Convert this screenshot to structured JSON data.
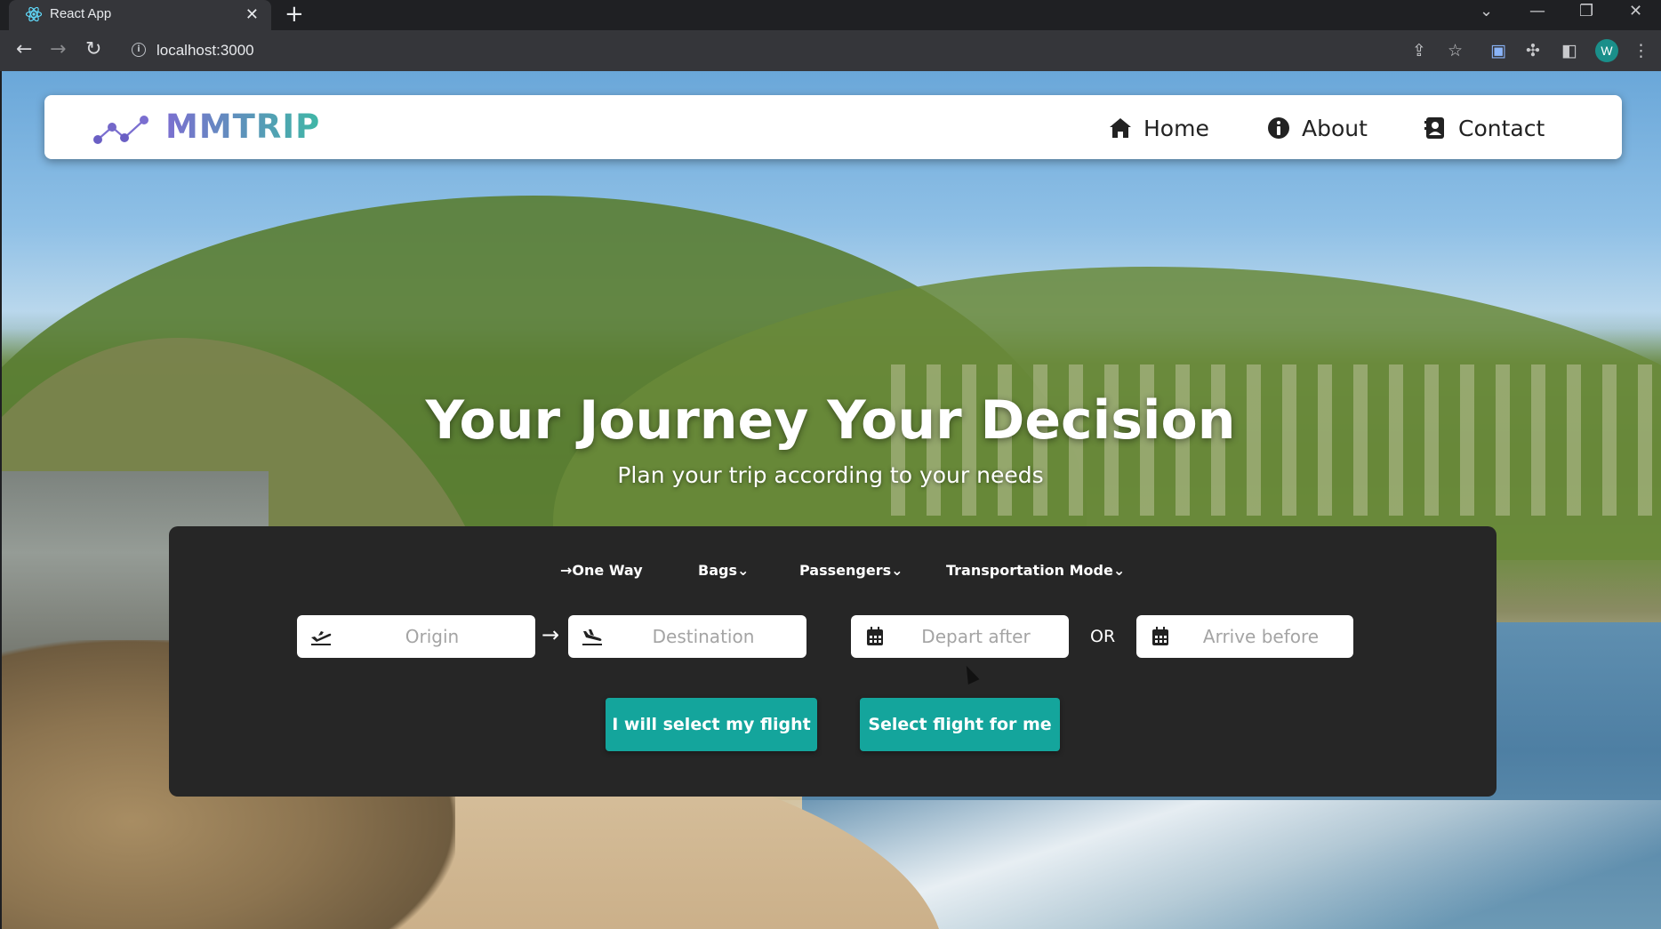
{
  "browser": {
    "tab_title": "React App",
    "tab_close_icon": "close-icon",
    "new_tab_label": "+",
    "url": "localhost:3000",
    "profile_initial": "W",
    "accent_profile_color": "#1a8f8a"
  },
  "navbar": {
    "logo_text": "MMTRIP",
    "items": [
      {
        "label": "Home",
        "icon": "home-icon"
      },
      {
        "label": "About",
        "icon": "info-icon"
      },
      {
        "label": "Contact",
        "icon": "contact-card-icon"
      }
    ]
  },
  "hero": {
    "title": "Your Journey Your Decision",
    "subtitle": "Plan your trip according to your needs"
  },
  "search": {
    "options": {
      "trip_type": "One Way",
      "bags": "Bags",
      "passengers": "Passengers",
      "transportation_mode": "Transportation Mode"
    },
    "origin_placeholder": "Origin",
    "destination_placeholder": "Destination",
    "depart_placeholder": "Depart after",
    "or_label": "OR",
    "arrive_placeholder": "Arrive before",
    "select_my_flight_label": "I will select my flight",
    "select_for_me_label": "Select flight for me"
  },
  "colors": {
    "panel_bg": "#262626",
    "button_accent": "#14a59c",
    "logo_gradient_start": "#7b6fd0",
    "logo_gradient_end": "#3fb7a6"
  }
}
